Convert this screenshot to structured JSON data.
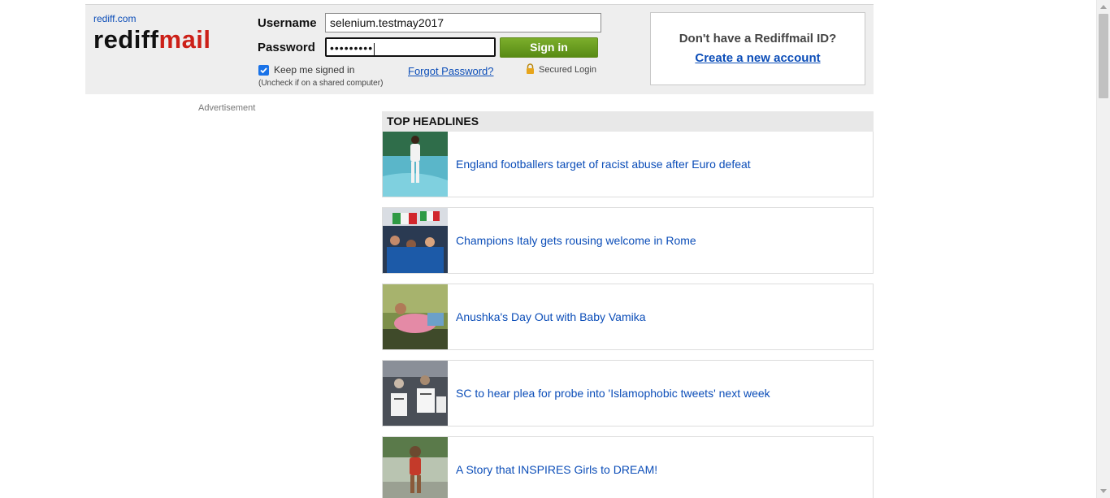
{
  "brand": {
    "site_link": "rediff.com",
    "logo_part1": "rediff",
    "logo_part2": "mail",
    "accent_color": "#cc2018"
  },
  "login": {
    "username_label": "Username",
    "username_value": "selenium.testmay2017",
    "password_label": "Password",
    "password_masked": "•••••••••",
    "signin_label": "Sign in",
    "keep_signed_in_label": "Keep me signed in",
    "keep_signed_in_checked": true,
    "keep_signed_in_note": "(Uncheck if on a shared computer)",
    "forgot_password_label": "Forgot Password?",
    "secured_login_label": "Secured Login",
    "button_color": "#6a9d22"
  },
  "signup": {
    "question": "Don't have a Rediffmail ID?",
    "create_account_label": "Create a new account"
  },
  "advertisement": {
    "label": "Advertisement"
  },
  "headlines": {
    "title": "TOP HEADLINES",
    "items": [
      {
        "text": "England footballers target of racist abuse after Euro defeat",
        "thumb_icon": "footballer-photo"
      },
      {
        "text": "Champions Italy gets rousing welcome in Rome",
        "thumb_icon": "crowd-flags-photo"
      },
      {
        "text": "Anushka's Day Out with Baby Vamika",
        "thumb_icon": "person-lying-photo"
      },
      {
        "text": "SC to hear plea for probe into 'Islamophobic tweets' next week",
        "thumb_icon": "protest-placards-photo"
      },
      {
        "text": "A Story that INSPIRES Girls to DREAM!",
        "thumb_icon": "girl-skater-photo"
      }
    ]
  }
}
